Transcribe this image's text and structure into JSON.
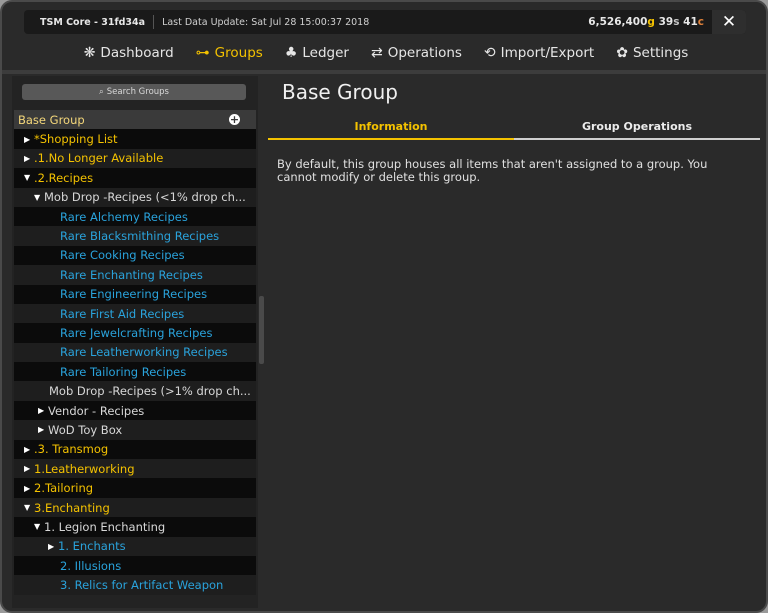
{
  "titlebar": {
    "app": "TSM Core - 31fd34a",
    "update": "Last Data Update: Sat Jul 28 15:00:37 2018",
    "gold": "6,526,400",
    "gold_unit": "g",
    "silver": "39",
    "silver_unit": "s",
    "copper": "41",
    "copper_unit": "c",
    "close": "✕"
  },
  "nav": [
    {
      "label": "Dashboard",
      "icon": "dashboard-icon"
    },
    {
      "label": "Groups",
      "icon": "groups-icon"
    },
    {
      "label": "Ledger",
      "icon": "ledger-icon"
    },
    {
      "label": "Operations",
      "icon": "operations-icon"
    },
    {
      "label": "Import/Export",
      "icon": "import-export-icon"
    },
    {
      "label": "Settings",
      "icon": "settings-icon"
    }
  ],
  "sidebar": {
    "search_placeholder": "Search Groups",
    "header": "Base Group",
    "rows": [
      {
        "label": "*Shopping List"
      },
      {
        "label": ".1.No Longer Available"
      },
      {
        "label": ".2.Recipes"
      },
      {
        "label": "Mob Drop -Recipes (<1% drop ch..."
      },
      {
        "label": "Rare Alchemy Recipes"
      },
      {
        "label": "Rare Blacksmithing Recipes"
      },
      {
        "label": "Rare Cooking Recipes"
      },
      {
        "label": "Rare Enchanting Recipes"
      },
      {
        "label": "Rare Engineering Recipes"
      },
      {
        "label": "Rare First Aid Recipes"
      },
      {
        "label": "Rare Jewelcrafting Recipes"
      },
      {
        "label": "Rare Leatherworking Recipes"
      },
      {
        "label": "Rare Tailoring Recipes"
      },
      {
        "label": "Mob Drop -Recipes (>1% drop ch..."
      },
      {
        "label": "Vendor - Recipes"
      },
      {
        "label": "WoD Toy Box"
      },
      {
        "label": ".3. Transmog"
      },
      {
        "label": "1.Leatherworking"
      },
      {
        "label": "2.Tailoring"
      },
      {
        "label": "3.Enchanting"
      },
      {
        "label": "1. Legion Enchanting"
      },
      {
        "label": "1. Enchants"
      },
      {
        "label": "2. Illusions"
      },
      {
        "label": "3. Relics for Artifact Weapon"
      }
    ]
  },
  "main": {
    "title": "Base Group",
    "tabs": [
      "Information",
      "Group Operations"
    ],
    "description": "By default, this group houses all items that aren't assigned to a group. You cannot modify or delete this group."
  },
  "colors": {
    "accent": "#f4c200",
    "link_blue": "#2aa3dc",
    "background": "#2a2a2a"
  }
}
